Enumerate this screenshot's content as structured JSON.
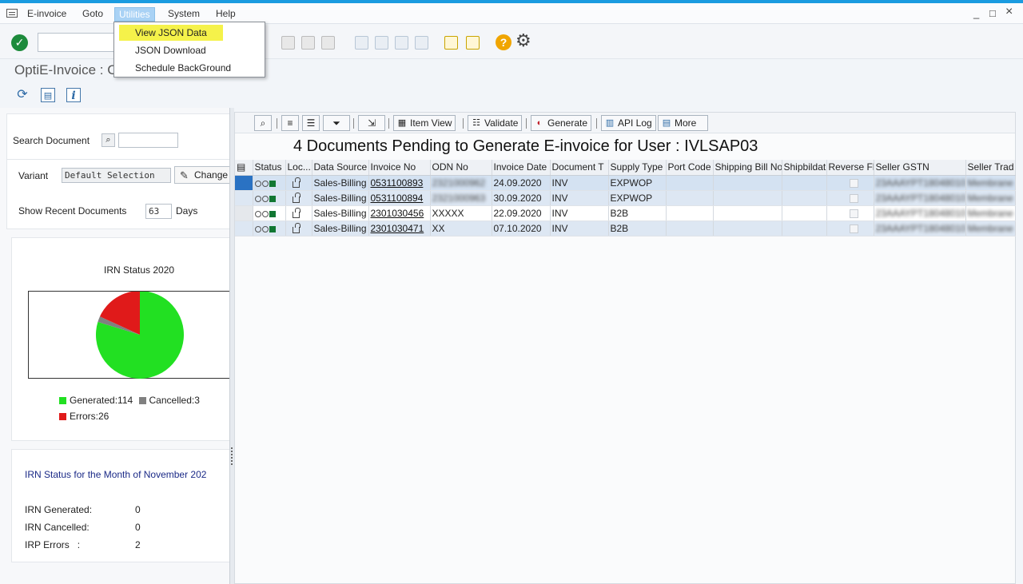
{
  "menubar": {
    "items": [
      "E-invoice",
      "Goto",
      "Utilities",
      "System",
      "Help"
    ],
    "window_controls": [
      "_",
      "□",
      "×"
    ]
  },
  "utilities_menu": {
    "items": [
      "View JSON Data",
      "JSON Download",
      "Schedule BackGround"
    ]
  },
  "title": "OptiE-Invoice : C",
  "left": {
    "search_label": "Search Document",
    "search_value": "",
    "variant_label": "Variant",
    "variant_value": "Default Selection",
    "change_button": "Change",
    "recent_label": "Show Recent Documents",
    "recent_value": "63",
    "recent_unit": "Days"
  },
  "chart_data": {
    "type": "pie",
    "title": "IRN Status 2020",
    "categories": [
      "Generated",
      "Cancelled",
      "Errors"
    ],
    "values": [
      114,
      3,
      26
    ],
    "colors": [
      "#22e022",
      "#808080",
      "#e01a1a"
    ],
    "legend": [
      "Generated:114",
      "Cancelled:3",
      "Errors:26"
    ]
  },
  "month_status": {
    "title": "IRN Status for the Month of November 202",
    "rows": [
      {
        "label": "IRN Generated:",
        "value": "0"
      },
      {
        "label": "IRN Cancelled:",
        "value": "0"
      },
      {
        "label": "IRP Errors   :",
        "value": "2"
      }
    ]
  },
  "grid_toolbar": {
    "item_view": "Item View",
    "validate": "Validate",
    "generate": "Generate",
    "api_log": "API Log",
    "more": "More"
  },
  "grid_title": "4 Documents Pending to Generate E-invoice for User : IVLSAP03",
  "table": {
    "headers": [
      "Status",
      "Loc...",
      "Data Source",
      "Invoice No",
      "ODN No",
      "Invoice Date",
      "Document T",
      "Supply Type",
      "Port Code",
      "Shipping Bill No",
      "Shipbildat",
      "Reverse Fl",
      "Seller GSTN",
      "Seller Trad"
    ],
    "rows": [
      {
        "source": "Sales-Billing",
        "invoice": "0531100893",
        "odn": "2321000962",
        "date": "24.09.2020",
        "doc": "INV",
        "supply": "EXPWOP",
        "gstn": "23AAAYPT18048010",
        "trade": "Membrane"
      },
      {
        "source": "Sales-Billing",
        "invoice": "0531100894",
        "odn": "2321000963",
        "date": "30.09.2020",
        "doc": "INV",
        "supply": "EXPWOP",
        "gstn": "23AAAYPT18048010",
        "trade": "Membrane"
      },
      {
        "source": "Sales-Billing",
        "invoice": "2301030456",
        "odn": "XXXXX",
        "date": "22.09.2020",
        "doc": "INV",
        "supply": "B2B",
        "gstn": "23AAAYPT18048010",
        "trade": "Membrane"
      },
      {
        "source": "Sales-Billing",
        "invoice": "2301030471",
        "odn": "XX",
        "date": "07.10.2020",
        "doc": "INV",
        "supply": "B2B",
        "gstn": "23AAAYPT18048010",
        "trade": "Membrane"
      }
    ]
  }
}
